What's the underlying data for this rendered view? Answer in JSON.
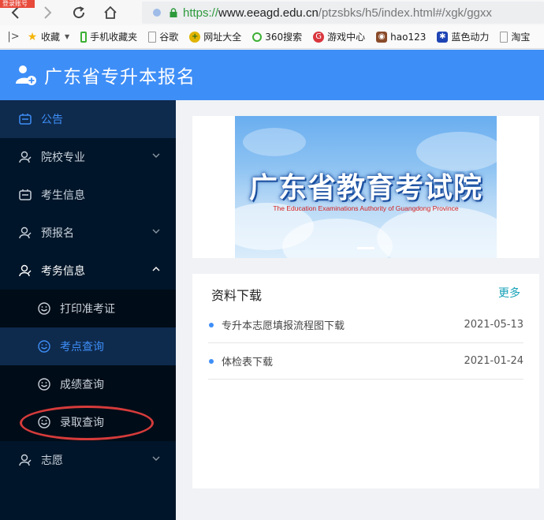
{
  "browser": {
    "corner_tag": "登录账号",
    "url_scheme": "https://",
    "url_host": "www.eeagd.edu.cn",
    "url_path": "/ptzsbks/h5/index.html#/xgk/ggxx",
    "bookmarks": [
      {
        "label": "收藏",
        "icon": "star-icon",
        "color": "#f5b50a"
      },
      {
        "label": "手机收藏夹",
        "icon": "phone-icon",
        "color": "#3cb034"
      },
      {
        "label": "谷歌",
        "icon": "page-icon",
        "color": "#999999"
      },
      {
        "label": "网址大全",
        "icon": "plus-icon",
        "color": "#e0b400"
      },
      {
        "label": "360搜索",
        "icon": "search-360-icon",
        "color": "#3cb034"
      },
      {
        "label": "游戏中心",
        "icon": "game-icon",
        "color": "#d9363e"
      },
      {
        "label": "hao123",
        "icon": "hao123-icon",
        "color": "#8a4b2a"
      },
      {
        "label": "蓝色动力",
        "icon": "paw-icon",
        "color": "#1e44b4"
      },
      {
        "label": "淘宝",
        "icon": "page-icon",
        "color": "#999999"
      }
    ]
  },
  "header": {
    "title": "广东省专升本报名",
    "accent": "#3e8ef7"
  },
  "sidebar": {
    "items": [
      {
        "label": "公告",
        "icon": "notice-icon",
        "active": true
      },
      {
        "label": "院校专业",
        "icon": "user-icon",
        "arrow": "down"
      },
      {
        "label": "考生信息",
        "icon": "card-icon"
      },
      {
        "label": "预报名",
        "icon": "user-icon",
        "arrow": "down"
      },
      {
        "label": "考务信息",
        "icon": "user-icon",
        "arrow": "up"
      }
    ],
    "sub_items": [
      {
        "label": "打印准考证",
        "icon": "smile-icon"
      },
      {
        "label": "考点查询",
        "icon": "smile-icon",
        "active": true
      },
      {
        "label": "成绩查询",
        "icon": "smile-icon"
      },
      {
        "label": "录取查询",
        "icon": "smile-icon"
      }
    ],
    "last_item": {
      "label": "志愿",
      "icon": "user-icon",
      "arrow": "down"
    }
  },
  "banner": {
    "title": "广东省教育考试院",
    "subtitle": "The Education Examinations Authority of Guangdong Province"
  },
  "downloads": {
    "heading": "资料下载",
    "more": "更多",
    "rows": [
      {
        "title": "专升本志愿填报流程图下载",
        "date": "2021-05-13"
      },
      {
        "title": "体检表下载",
        "date": "2021-01-24"
      }
    ]
  }
}
